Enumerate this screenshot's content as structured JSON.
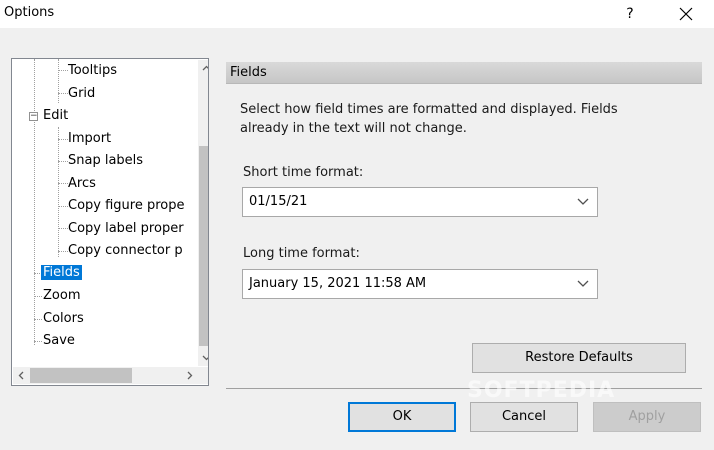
{
  "window": {
    "title": "Options",
    "help_label": "?"
  },
  "tree": {
    "items": [
      {
        "label": "Tooltips"
      },
      {
        "label": "Grid"
      },
      {
        "label": "Edit",
        "expander": "−"
      },
      {
        "label": "Import"
      },
      {
        "label": "Snap labels"
      },
      {
        "label": "Arcs"
      },
      {
        "label": "Copy figure prope"
      },
      {
        "label": "Copy label proper"
      },
      {
        "label": "Copy connector p"
      },
      {
        "label": "Fields",
        "selected": true
      },
      {
        "label": "Zoom"
      },
      {
        "label": "Colors"
      },
      {
        "label": "Save"
      }
    ]
  },
  "panel": {
    "title": "Fields",
    "description": "Select how field times are formatted and displayed. Fields already in the text will not change.",
    "short_time": {
      "label": "Short time format:",
      "value": "01/15/21"
    },
    "long_time": {
      "label": "Long time format:",
      "value": "January 15, 2021 11:58 AM"
    },
    "restore_label": "Restore Defaults"
  },
  "footer": {
    "ok_label": "OK",
    "cancel_label": "Cancel",
    "apply_label": "Apply",
    "watermark": "SOFTPEDIA"
  },
  "colors": {
    "selection": "#0078d7",
    "panel_header": "#d0d0d0"
  }
}
